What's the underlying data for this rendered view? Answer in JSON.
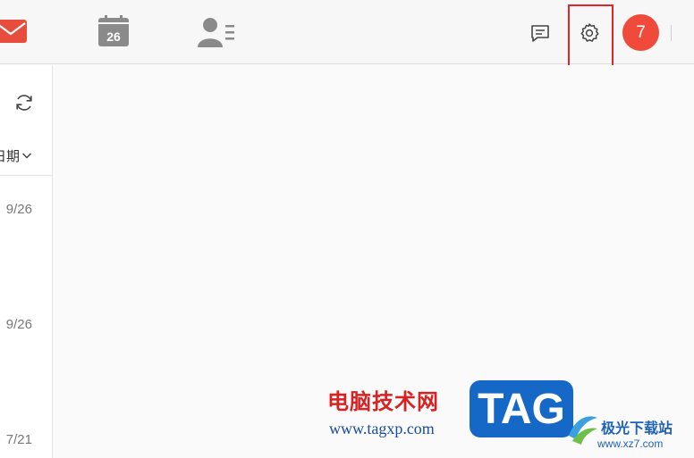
{
  "nav": {
    "calendar_day": "26"
  },
  "header": {
    "avatar_initial": "7"
  },
  "list": {
    "sort_label": "日期",
    "items": [
      {
        "date": "9/26"
      },
      {
        "date": "9/26"
      },
      {
        "date": "7/21"
      }
    ]
  },
  "watermark": {
    "site_cn": "电脑技术网",
    "site_url": "www.tagxp.com",
    "tag": "TAG",
    "logo_cn": "极光下载站",
    "logo_url": "www.xz7.com"
  },
  "colors": {
    "accent": "#ef4a3a",
    "mail_icon": "#e84c3d",
    "icon_gray": "#8a8a8a",
    "highlight": "#e0252b"
  }
}
